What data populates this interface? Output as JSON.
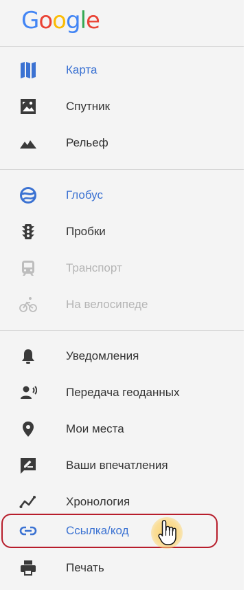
{
  "logo": {
    "letters": [
      {
        "char": "G",
        "color": "#4285F4"
      },
      {
        "char": "o",
        "color": "#EA4335"
      },
      {
        "char": "o",
        "color": "#FBBC05"
      },
      {
        "char": "g",
        "color": "#4285F4"
      },
      {
        "char": "l",
        "color": "#34A853"
      },
      {
        "char": "e",
        "color": "#EA4335"
      }
    ]
  },
  "colors": {
    "active": "#3b72d2",
    "text": "#333333",
    "disabled": "#b5b5b5",
    "highlight_border": "#b71d2b"
  },
  "menu": {
    "karta": {
      "label": "Карта",
      "icon": "map-icon"
    },
    "sputnik": {
      "label": "Спутник",
      "icon": "satellite-icon"
    },
    "relief": {
      "label": "Рельеф",
      "icon": "terrain-icon"
    },
    "globus": {
      "label": "Глобус",
      "icon": "globe-icon"
    },
    "traffic": {
      "label": "Пробки",
      "icon": "traffic-light-icon"
    },
    "transit": {
      "label": "Транспорт",
      "icon": "transit-icon"
    },
    "bicycle": {
      "label": "На велосипеде",
      "icon": "bicycle-icon"
    },
    "notifications": {
      "label": "Уведомления",
      "icon": "bell-icon"
    },
    "location_sharing": {
      "label": "Передача геоданных",
      "icon": "location-sharing-icon"
    },
    "my_places": {
      "label": "Мои места",
      "icon": "place-pin-icon"
    },
    "contributions": {
      "label": "Ваши впечатления",
      "icon": "feedback-pencil-icon"
    },
    "timeline": {
      "label": "Хронология",
      "icon": "timeline-icon"
    },
    "share_link": {
      "label": "Ссылка/код",
      "icon": "link-icon"
    },
    "print": {
      "label": "Печать",
      "icon": "printer-icon"
    }
  }
}
